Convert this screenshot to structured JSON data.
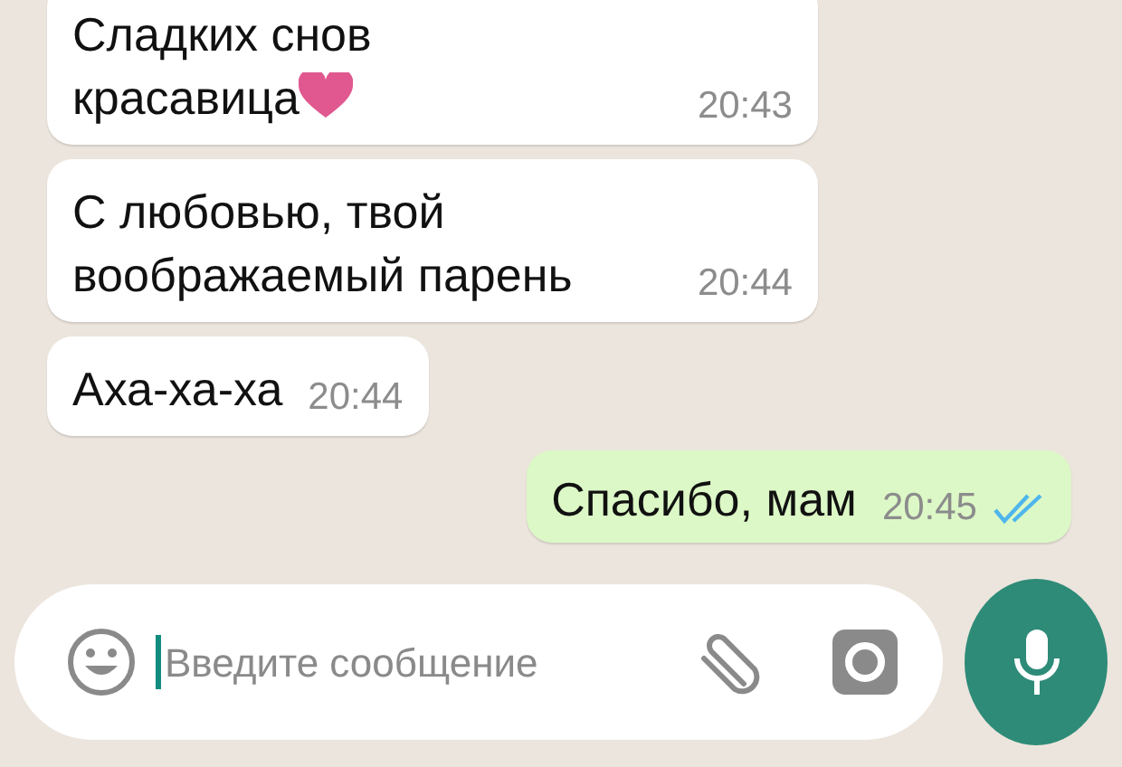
{
  "messages": [
    {
      "text": "Сладких снов\nкрасавица",
      "heart": true,
      "time": "20:43",
      "outgoing": false
    },
    {
      "text": "С любовью, твой\nвоображаемый парень",
      "heart": false,
      "time": "20:44",
      "outgoing": false
    },
    {
      "text": "Аха-ха-ха",
      "heart": false,
      "time": "20:44",
      "outgoing": false
    },
    {
      "text": "Спасибо, мам",
      "heart": false,
      "time": "20:45",
      "outgoing": true,
      "read": true
    }
  ],
  "composer": {
    "placeholder": "Введите сообщение"
  }
}
